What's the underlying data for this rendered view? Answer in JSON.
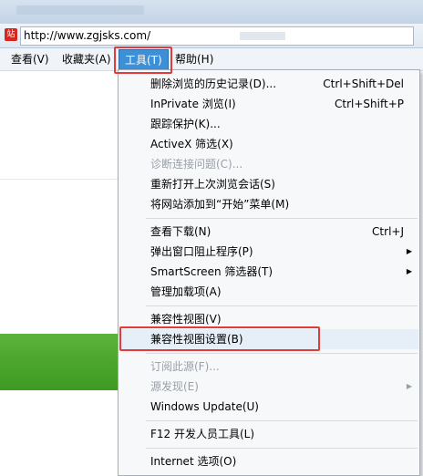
{
  "address": {
    "url": "http://www.zgjsks.com/",
    "site_icon": "站"
  },
  "menubar": {
    "items": [
      {
        "label": "查看(V)"
      },
      {
        "label": "收藏夹(A)"
      },
      {
        "label": "工具(T)"
      },
      {
        "label": "帮助(H)"
      }
    ]
  },
  "tools_menu": {
    "groups": [
      [
        {
          "label": "删除浏览的历史记录(D)...",
          "shortcut": "Ctrl+Shift+Del"
        },
        {
          "label": "InPrivate 浏览(I)",
          "shortcut": "Ctrl+Shift+P"
        },
        {
          "label": "跟踪保护(K)..."
        },
        {
          "label": "ActiveX 筛选(X)"
        },
        {
          "label": "诊断连接问题(C)...",
          "disabled": true
        },
        {
          "label": "重新打开上次浏览会话(S)"
        },
        {
          "label": "将网站添加到“开始”菜单(M)"
        }
      ],
      [
        {
          "label": "查看下载(N)",
          "shortcut": "Ctrl+J"
        },
        {
          "label": "弹出窗口阻止程序(P)",
          "submenu": true
        },
        {
          "label": "SmartScreen 筛选器(T)",
          "submenu": true
        },
        {
          "label": "管理加载项(A)"
        }
      ],
      [
        {
          "label": "兼容性视图(V)"
        },
        {
          "label": "兼容性视图设置(B)"
        }
      ],
      [
        {
          "label": "订阅此源(F)...",
          "disabled": true
        },
        {
          "label": "源发现(E)",
          "disabled": true,
          "submenu": true
        },
        {
          "label": "Windows Update(U)"
        }
      ],
      [
        {
          "label": "F12 开发人员工具(L)"
        }
      ],
      [
        {
          "label": "Internet 选项(O)"
        }
      ]
    ]
  },
  "icons": {
    "submenu_arrow": "▶"
  },
  "colors": {
    "active_menu": "#3d8fd6",
    "highlight_frame": "#e23b3b",
    "banner_green": "#4aa82c"
  }
}
